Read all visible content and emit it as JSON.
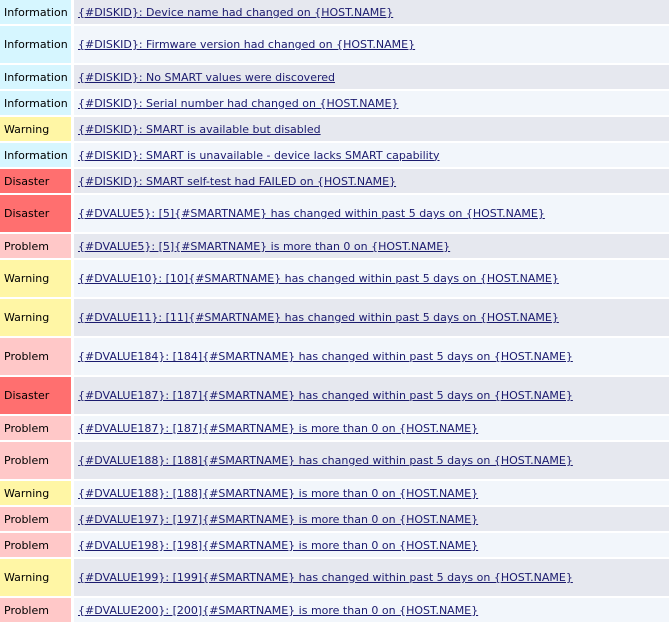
{
  "severity_colors": {
    "Information": "#d6f6ff",
    "Warning": "#fff6a5",
    "Disaster": "#ff6f6f",
    "Problem": "#ffc8c8"
  },
  "triggers": [
    {
      "severity": "Information",
      "description": "{#DISKID}: Device name had changed on {HOST.NAME}"
    },
    {
      "severity": "Information",
      "description": "{#DISKID}: Firmware version had changed on {HOST.NAME}"
    },
    {
      "severity": "Information",
      "description": "{#DISKID}: No SMART values were discovered"
    },
    {
      "severity": "Information",
      "description": "{#DISKID}: Serial number had changed on {HOST.NAME}"
    },
    {
      "severity": "Warning",
      "description": "{#DISKID}: SMART is available but disabled"
    },
    {
      "severity": "Information",
      "description": "{#DISKID}: SMART is unavailable - device lacks SMART capability"
    },
    {
      "severity": "Disaster",
      "description": "{#DISKID}: SMART self-test had FAILED on {HOST.NAME}"
    },
    {
      "severity": "Disaster",
      "description": "{#DVALUE5}: [5]{#SMARTNAME} has changed within past 5 days on {HOST.NAME}"
    },
    {
      "severity": "Problem",
      "description": "{#DVALUE5}: [5]{#SMARTNAME} is more than 0 on {HOST.NAME}"
    },
    {
      "severity": "Warning",
      "description": "{#DVALUE10}: [10]{#SMARTNAME} has changed within past 5 days on {HOST.NAME}"
    },
    {
      "severity": "Warning",
      "description": "{#DVALUE11}: [11]{#SMARTNAME} has changed within past 5 days on {HOST.NAME}"
    },
    {
      "severity": "Problem",
      "description": "{#DVALUE184}: [184]{#SMARTNAME} has changed within past 5 days on {HOST.NAME}"
    },
    {
      "severity": "Disaster",
      "description": "{#DVALUE187}: [187]{#SMARTNAME} has changed within past 5 days on {HOST.NAME}"
    },
    {
      "severity": "Problem",
      "description": "{#DVALUE187}: [187]{#SMARTNAME} is more than 0 on {HOST.NAME}"
    },
    {
      "severity": "Problem",
      "description": "{#DVALUE188}: [188]{#SMARTNAME} has changed within past 5 days on {HOST.NAME}"
    },
    {
      "severity": "Warning",
      "description": "{#DVALUE188}: [188]{#SMARTNAME} is more than 0 on {HOST.NAME}"
    },
    {
      "severity": "Problem",
      "description": "{#DVALUE197}: [197]{#SMARTNAME} is more than 0 on {HOST.NAME}"
    },
    {
      "severity": "Problem",
      "description": "{#DVALUE198}: [198]{#SMARTNAME} is more than 0 on {HOST.NAME}"
    },
    {
      "severity": "Warning",
      "description": "{#DVALUE199}: [199]{#SMARTNAME} has changed within past 5 days on {HOST.NAME}"
    },
    {
      "severity": "Problem",
      "description": "{#DVALUE200}: [200]{#SMARTNAME} is more than 0 on {HOST.NAME}"
    }
  ]
}
